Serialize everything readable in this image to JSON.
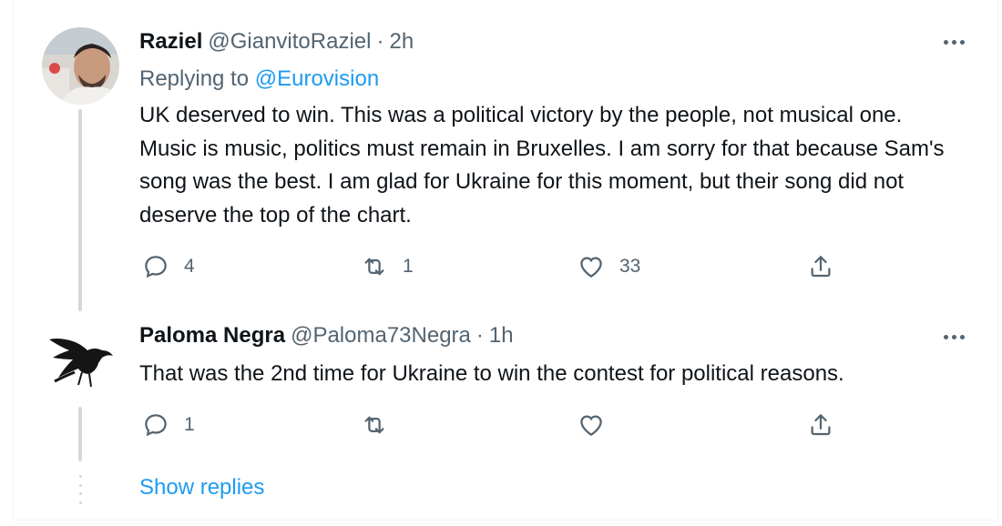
{
  "tweets": [
    {
      "name": "Raziel",
      "handle": "@GianvitoRaziel",
      "separator": "·",
      "time": "2h",
      "replying_prefix": "Replying to",
      "replying_to": "@Eurovision",
      "text": "UK deserved to win. This was a political victory by the people, not musical one. Music is music, politics must remain in Bruxelles. I am sorry for that because Sam's song was the best. I am glad for Ukraine for this moment, but their song did not deserve the top of the chart.",
      "replies": "4",
      "retweets": "1",
      "likes": "33",
      "avatar_icon": "person-photo"
    },
    {
      "name": "Paloma Negra",
      "handle": "@Paloma73Negra",
      "separator": "·",
      "time": "1h",
      "text": "That was the 2nd time for Ukraine to win the contest for political reasons.",
      "replies": "1",
      "retweets": "",
      "likes": "",
      "avatar_icon": "black-bird-drawing"
    }
  ],
  "show_replies": "Show replies",
  "colors": {
    "text": "#0f1419",
    "secondary": "#536471",
    "accent": "#1d9bf0",
    "thread_line": "#cfd9de"
  }
}
